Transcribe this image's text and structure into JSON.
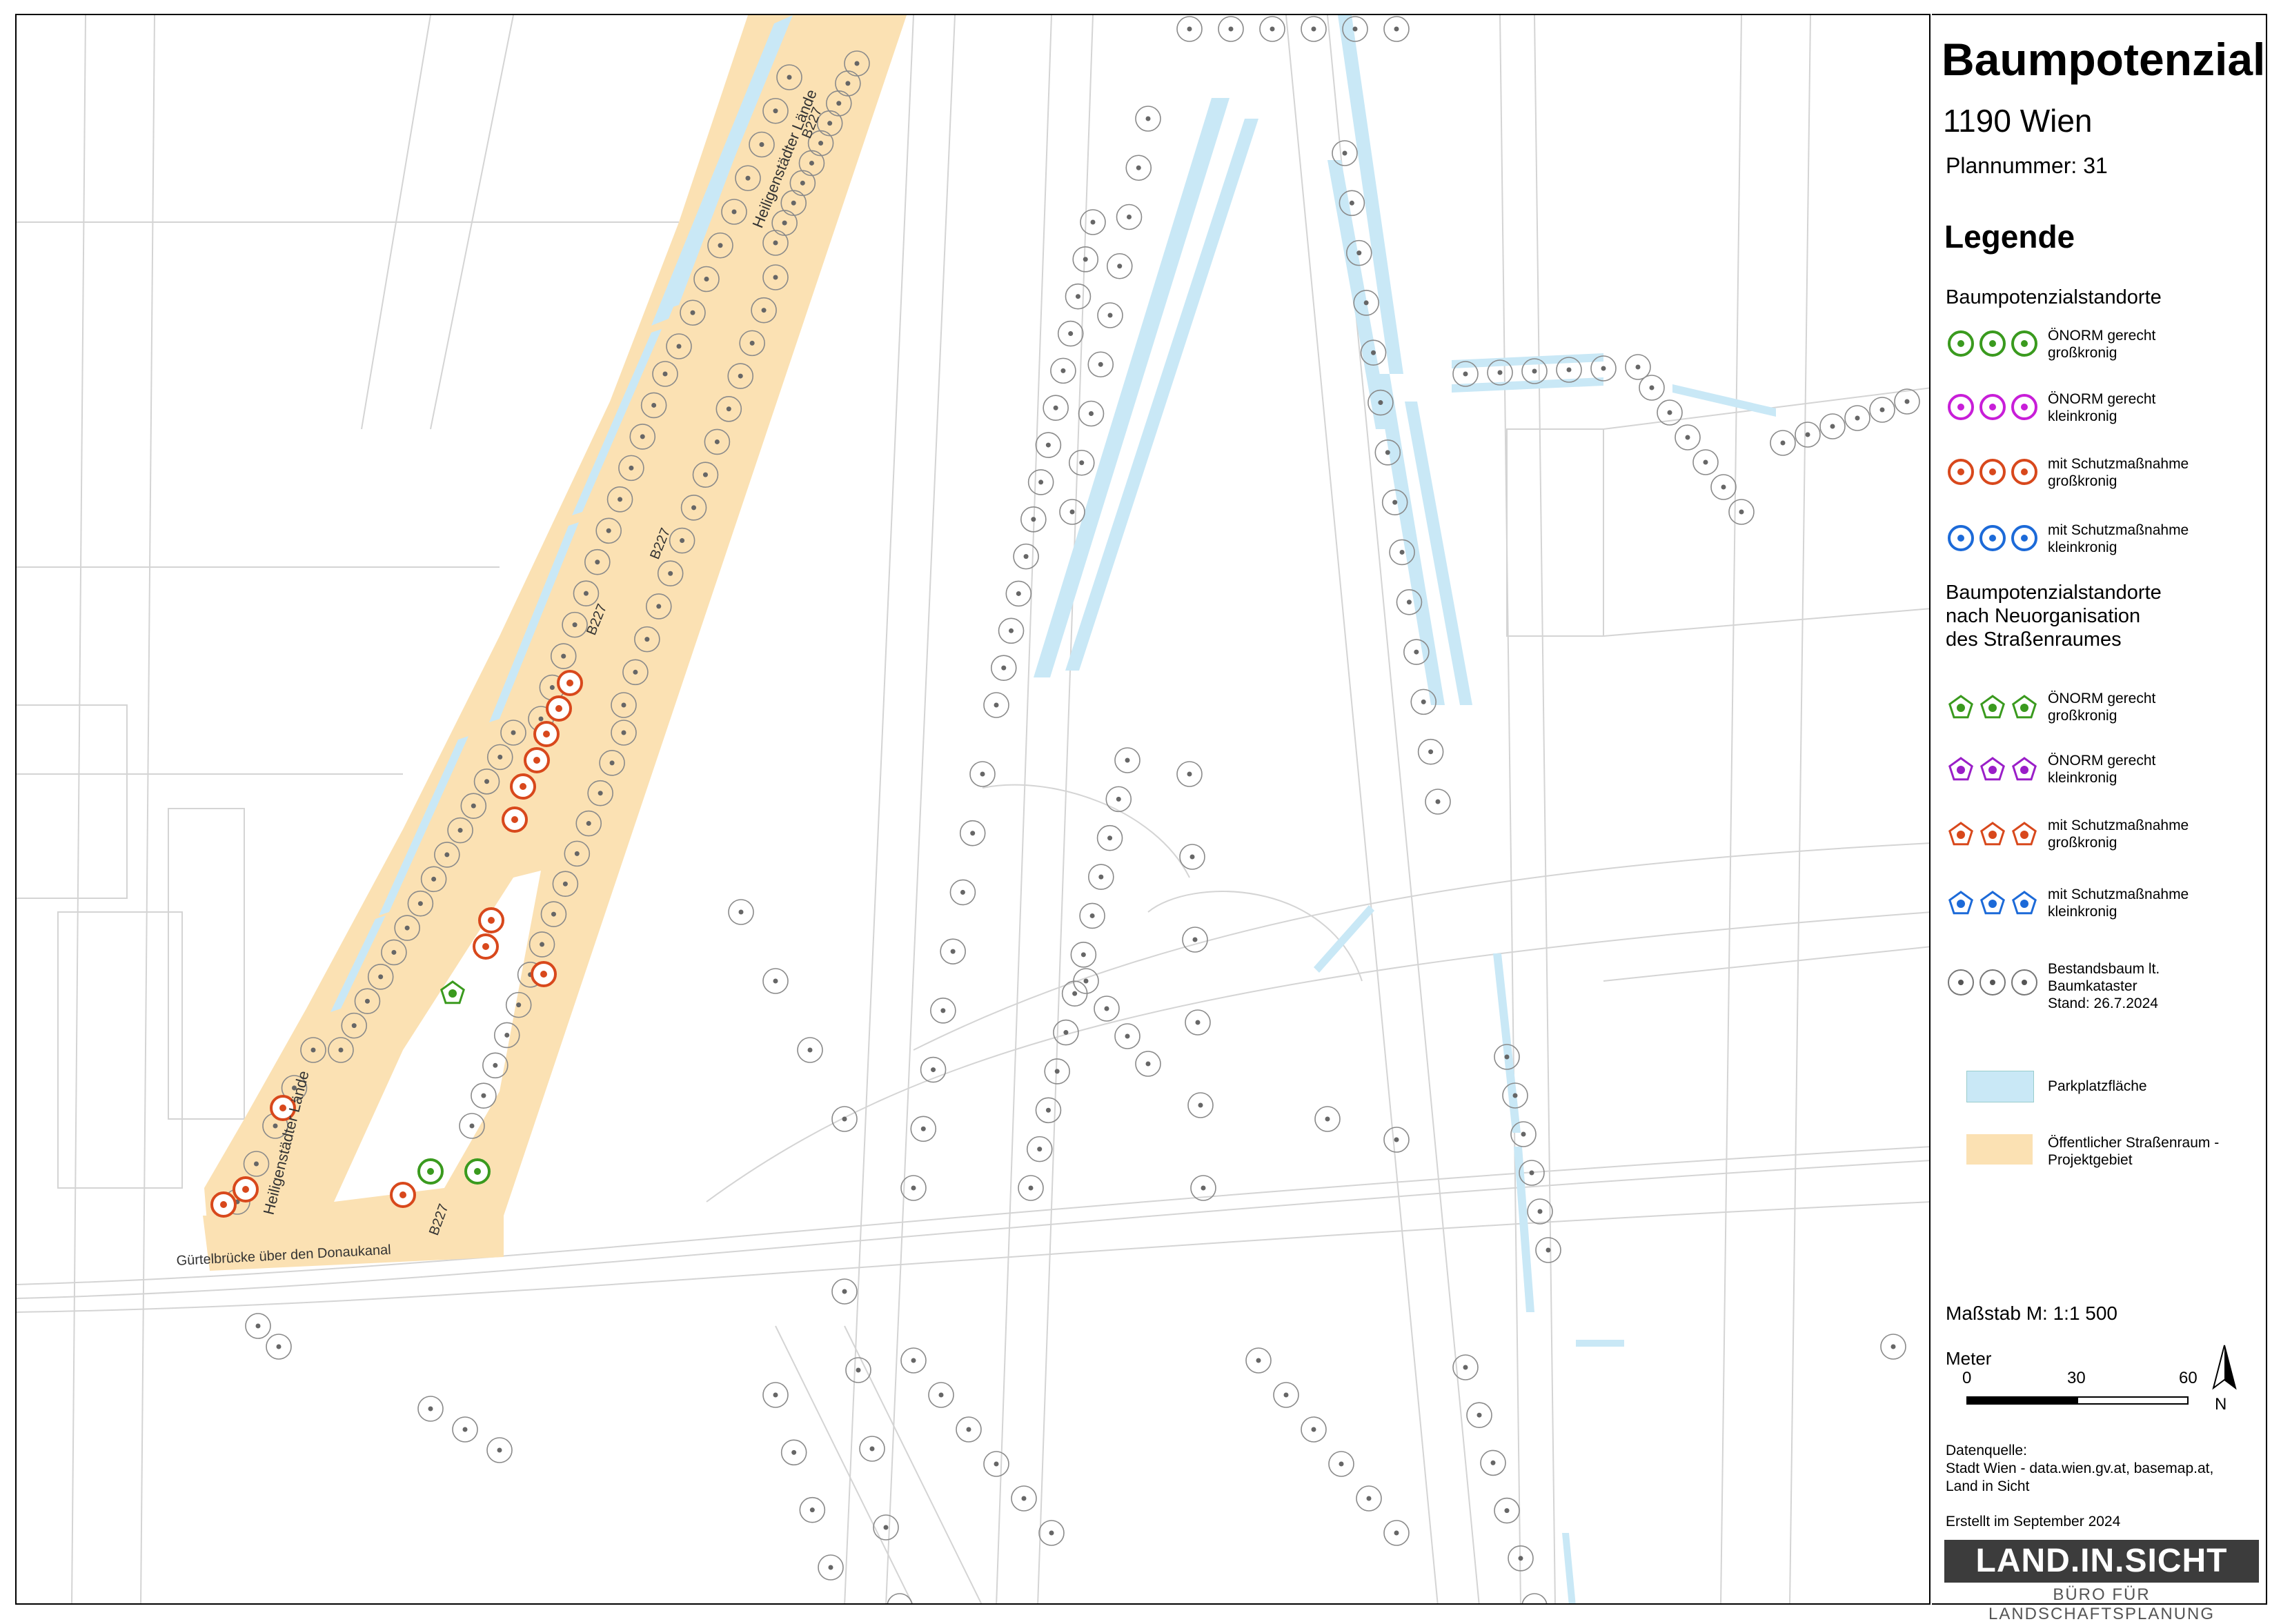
{
  "title": "Baumpotenzial",
  "subtitle": "1190 Wien",
  "plan_number": "Plannummer: 31",
  "legend": {
    "heading": "Legende",
    "section_1": "Baumpotenzialstandorte",
    "section_2_line1": "Baumpotenzialstandorte",
    "section_2_line2": "nach Neuorganisation",
    "section_2_line3": "des Straßenraumes",
    "items": [
      {
        "line1": "ÖNORM gerecht",
        "line2": "großkronig",
        "color": "#3a9a1e",
        "shape": "circle"
      },
      {
        "line1": "ÖNORM gerecht",
        "line2": "kleinkronig",
        "color": "#c81ed8",
        "shape": "circle"
      },
      {
        "line1": "mit Schutzmaßnahme",
        "line2": "großkronig",
        "color": "#d8481c",
        "shape": "circle"
      },
      {
        "line1": "mit Schutzmaßnahme",
        "line2": "kleinkronig",
        "color": "#1c6ad8",
        "shape": "circle"
      },
      {
        "line1": "ÖNORM gerecht",
        "line2": "großkronig",
        "color": "#3a9a1e",
        "shape": "pentagon"
      },
      {
        "line1": "ÖNORM gerecht",
        "line2": "kleinkronig",
        "color": "#9a1ec8",
        "shape": "pentagon"
      },
      {
        "line1": "mit Schutzmaßnahme",
        "line2": "großkronig",
        "color": "#d8481c",
        "shape": "pentagon"
      },
      {
        "line1": "mit Schutzmaßnahme",
        "line2": "kleinkronig",
        "color": "#1c6ad8",
        "shape": "pentagon"
      }
    ],
    "existing_tree": {
      "line1": "Bestandsbaum lt.",
      "line2": "Baumkataster",
      "line3": "Stand: 26.7.2024",
      "color": "#555555"
    },
    "parking": {
      "label": "Parkplatzfläche",
      "color": "#c9e8f6"
    },
    "street": {
      "label": "Öffentlicher Straßenraum -",
      "label2": "Projektgebiet",
      "color": "#fbe1b3"
    }
  },
  "scale": {
    "label": "Maßstab M: 1:1 500",
    "unit": "Meter",
    "ticks": [
      "0",
      "30",
      "60"
    ],
    "north": "N"
  },
  "source": {
    "line1": "Datenquelle:",
    "line2": "Stadt Wien - data.wien.gv.at, basemap.at,",
    "line3": "Land in Sicht"
  },
  "created": "Erstellt im September 2024",
  "logo": {
    "main": "LAND.IN.SICHT",
    "sub": "BÜRO FÜR LANDSCHAFTSPLANUNG"
  },
  "map": {
    "street_labels": [
      "Heiligenstädter Lände",
      "Heiligenstädter Lände",
      "B227",
      "B227",
      "B227",
      "B227",
      "Gürtelbrücke über den Donaukanal"
    ]
  }
}
